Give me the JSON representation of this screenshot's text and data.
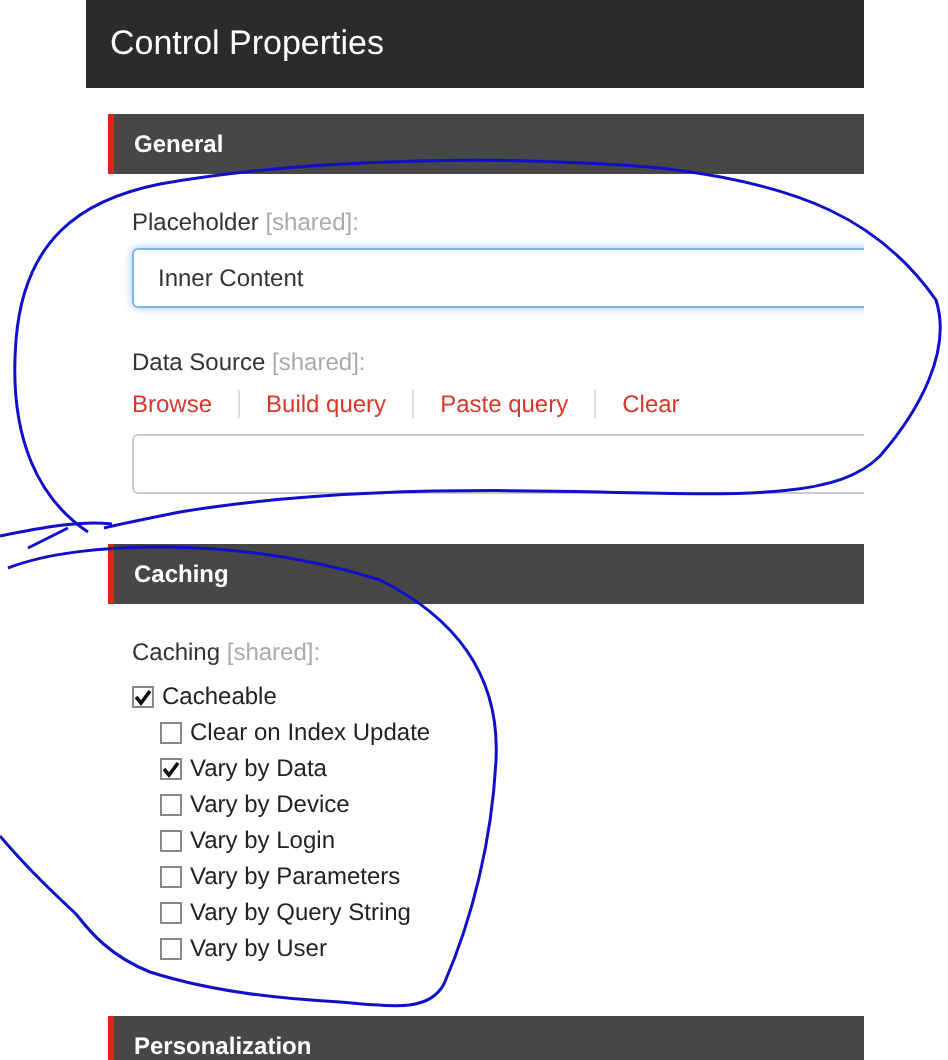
{
  "window": {
    "title": "Control Properties"
  },
  "sections": [
    {
      "title": "General",
      "fields": [
        {
          "kind": "text",
          "label": "Placeholder",
          "tag": "[shared]:",
          "value": "Inner Content",
          "focused": true
        },
        {
          "kind": "source",
          "label": "Data Source",
          "tag": "[shared]:",
          "links": [
            "Browse",
            "Build query",
            "Paste query",
            "Clear"
          ],
          "focused": false
        }
      ]
    },
    {
      "title": "Caching",
      "fields": [
        {
          "kind": "checks",
          "label": "Caching",
          "tag": "[shared]:",
          "options": [
            {
              "label": "Cacheable",
              "checked": true,
              "children": [
                {
                  "label": "Clear on Index Update",
                  "checked": false
                },
                {
                  "label": "Vary by Data",
                  "checked": true
                },
                {
                  "label": "Vary by Device",
                  "checked": false
                },
                {
                  "label": "Vary by Login",
                  "checked": false
                },
                {
                  "label": "Vary by Parameters",
                  "checked": false
                },
                {
                  "label": "Vary by Query String",
                  "checked": false
                },
                {
                  "label": "Vary by User",
                  "checked": false
                }
              ]
            }
          ]
        }
      ]
    },
    {
      "title": "Personalization"
    }
  ]
}
